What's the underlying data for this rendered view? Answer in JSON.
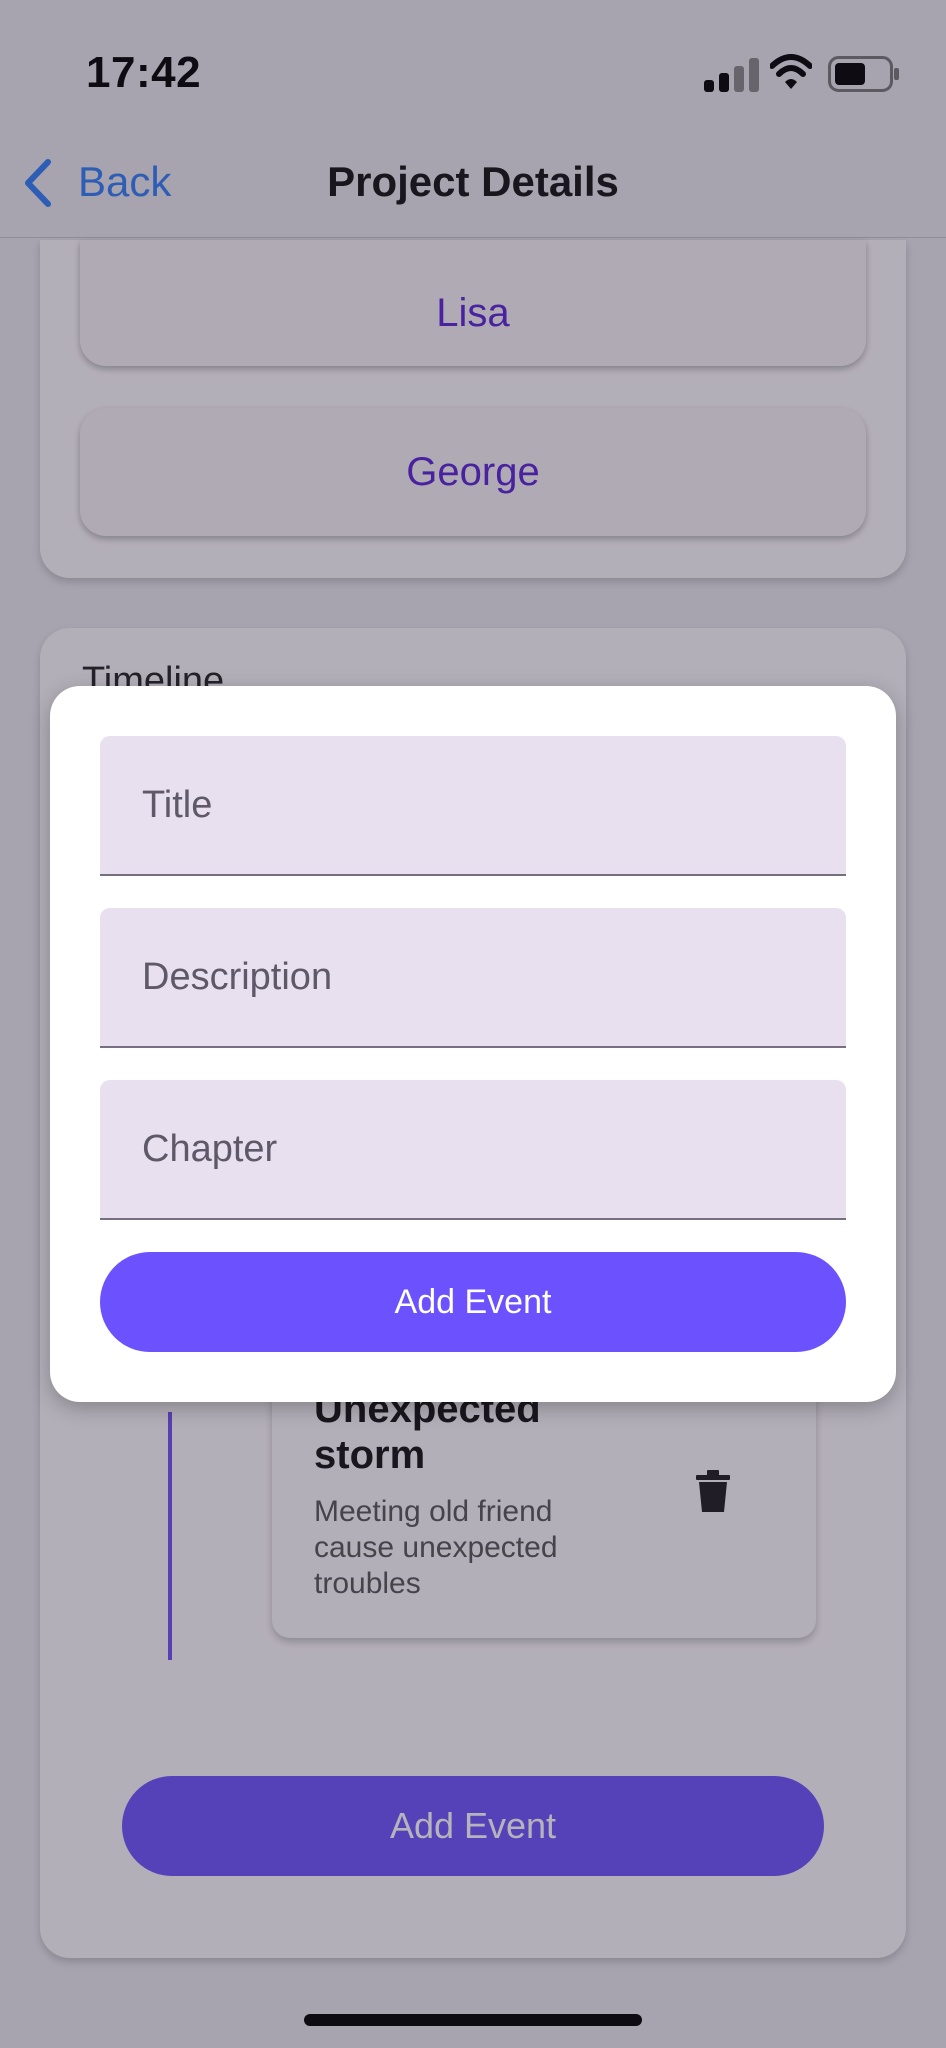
{
  "status_bar": {
    "time": "17:42"
  },
  "nav": {
    "back_label": "Back",
    "title": "Project Details"
  },
  "characters": [
    "Lisa",
    "George"
  ],
  "timeline": {
    "heading": "Timeline",
    "event": {
      "title": "Unexpected storm",
      "description": "Meeting old friend cause unexpected troubles"
    },
    "add_button_label": "Add Event"
  },
  "dialog": {
    "fields": [
      {
        "placeholder": "Title",
        "value": ""
      },
      {
        "placeholder": "Description",
        "value": ""
      },
      {
        "placeholder": "Chapter",
        "value": ""
      }
    ],
    "submit_label": "Add Event"
  },
  "colors": {
    "accent": "#6c52fe",
    "link": "#2f7bf6",
    "character_name": "#5a22d6",
    "field_bg": "#e8e0ee"
  },
  "icons": [
    "back-chevron-icon",
    "signal-icon",
    "wifi-icon",
    "battery-icon",
    "trash-icon"
  ]
}
